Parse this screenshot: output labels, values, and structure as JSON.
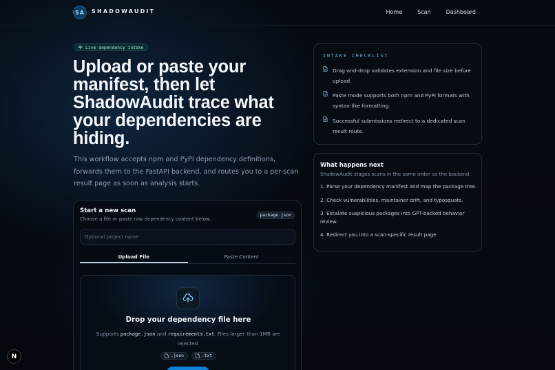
{
  "header": {
    "logo_initials": "SA",
    "brand": "SHADOWAUDIT",
    "nav": [
      "Home",
      "Scan",
      "Dashboard"
    ]
  },
  "hero": {
    "pill": "Live dependency intake",
    "title": "Upload or paste your manifest, then let ShadowAudit trace what your dependencies are hiding.",
    "lead": "This workflow accepts npm and PyPI dependency definitions, forwards them to the FastAPI backend, and routes you to a per-scan result page as soon as analysis starts."
  },
  "scan_card": {
    "title": "Start a new scan",
    "subtitle": "Choose a file or paste raw dependency content below.",
    "file_badge": "package.json",
    "project_placeholder": "Optional project name",
    "tabs": [
      "Upload File",
      "Paste Content"
    ],
    "active_tab": "Upload File",
    "dropzone": {
      "title": "Drop your dependency file here",
      "text_1": "Supports",
      "code_1": "package.json",
      "text_2": "and",
      "code_2": "requirements.txt",
      "text_3": ". Files larger than 1MB are rejected.",
      "extensions": [
        ".json",
        ".txt"
      ]
    }
  },
  "checklist": {
    "heading": "INTAKE CHECKLIST",
    "items": [
      "Drag-and-drop validates extension and file size before upload.",
      "Paste mode supports both npm and PyPI formats with syntax-like formatting.",
      "Successful submissions redirect to a dedicated scan result route."
    ]
  },
  "next_steps": {
    "title": "What happens next",
    "subtitle": "ShadowAudit stages scans in the same order as the backend.",
    "steps": [
      "1. Parse your dependency manifest and map the package tree.",
      "2. Check vulnerabilities, maintainer drift, and typosquats.",
      "3. Escalate suspicious packages into GPT-backed behavior review.",
      "4. Redirect you into a scan-specific result page."
    ]
  },
  "dev_badge": "N",
  "colors": {
    "background": "#05090f",
    "accent": "#0f7fd8",
    "pill_text": "#9de9d6",
    "checklist_heading": "#6fb7d8"
  }
}
